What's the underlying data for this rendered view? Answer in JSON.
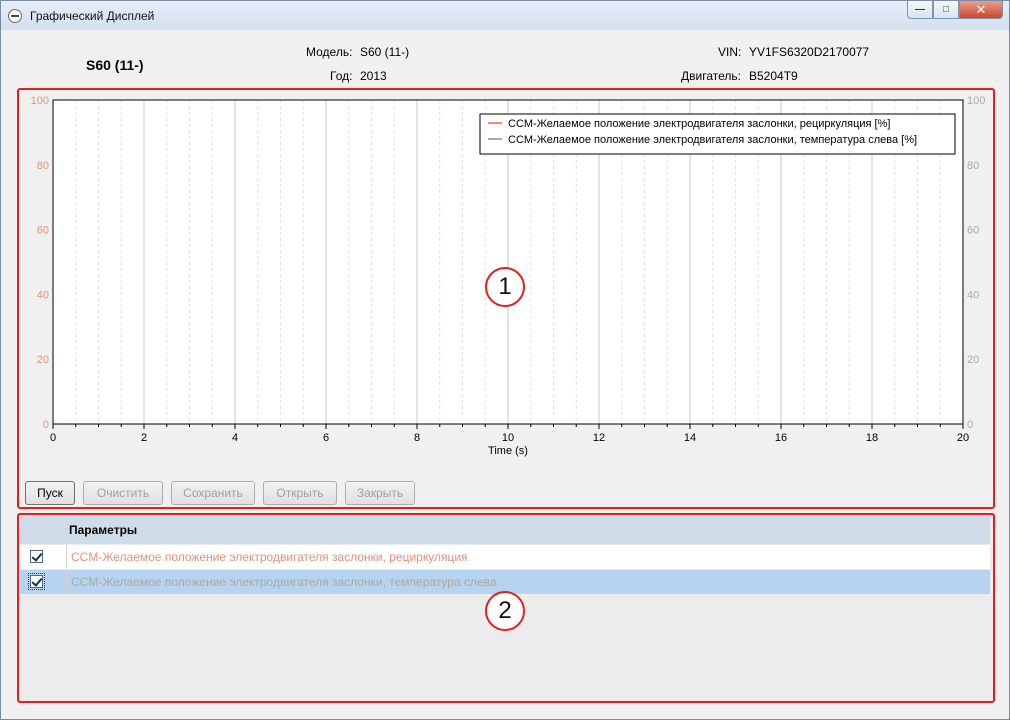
{
  "window": {
    "title": "Графический Дисплей",
    "min_glyph": "—",
    "max_glyph": "□",
    "close_glyph": "✕"
  },
  "header": {
    "model_big": "S60 (11-)",
    "model_label": "Модель",
    "model_value": "S60 (11-)",
    "year_label": "Год",
    "year_value": "2013",
    "vin_label": "VIN",
    "vin_value": "YV1FS6320D2170077",
    "engine_label": "Двигатель",
    "engine_value": "B5204T9",
    "colon": ":"
  },
  "chart_data": {
    "type": "line",
    "xlabel": "Time (s)",
    "xlim": [
      0,
      20
    ],
    "x_ticks": [
      0,
      2,
      4,
      6,
      8,
      10,
      12,
      14,
      16,
      18,
      20
    ],
    "ylim_left": [
      0,
      100
    ],
    "ylim_right": [
      0,
      100
    ],
    "y_ticks": [
      0,
      20,
      40,
      60,
      80,
      100
    ],
    "grid": true,
    "legend_position": "top-right",
    "left_axis_color": "#e8907a",
    "right_axis_color": "#a9a9a9",
    "series": [
      {
        "name": "CCM-Желаемое положение электродвигателя заслонки, рециркуляция [%]",
        "color": "#e8907a",
        "values": []
      },
      {
        "name": "CCM-Желаемое положение электродвигателя заслонки, температура слева [%]",
        "color": "#a9a9a9",
        "values": []
      }
    ]
  },
  "controls": {
    "start": "Пуск",
    "clear": "Очистить",
    "save": "Сохранить",
    "open": "Открыть",
    "close": "Закрыть"
  },
  "params": {
    "header": "Параметры",
    "rows": [
      {
        "label": "CCM-Желаемое положение электродвигателя заслонки, рециркуляция",
        "checked": true,
        "color": "#e8907a"
      },
      {
        "label": "CCM-Желаемое положение электродвигателя заслонки, температура слева",
        "checked": true,
        "color": "#a9a9a9"
      }
    ]
  },
  "annotations": {
    "marker_1": "1",
    "marker_2": "2"
  }
}
